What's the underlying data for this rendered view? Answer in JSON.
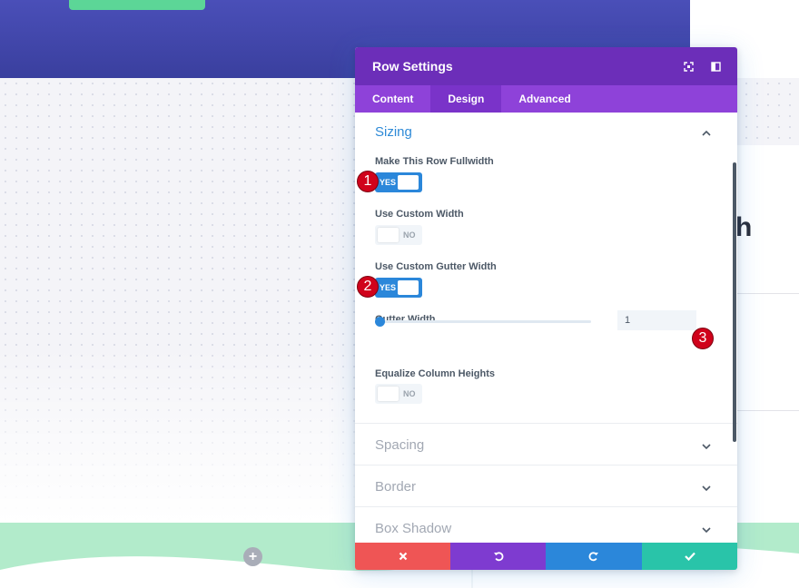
{
  "modal": {
    "title": "Row Settings",
    "tabs": [
      {
        "label": "Content",
        "active": false
      },
      {
        "label": "Design",
        "active": true
      },
      {
        "label": "Advanced",
        "active": false
      }
    ],
    "section_open": {
      "title": "Sizing",
      "options": [
        {
          "label": "Make This Row Fullwidth",
          "toggle": "YES"
        },
        {
          "label": "Use Custom Width",
          "toggle": "NO"
        },
        {
          "label": "Use Custom Gutter Width",
          "toggle": "YES"
        },
        {
          "label": "Gutter Width",
          "value": "1"
        },
        {
          "label": "Equalize Column Heights",
          "toggle": "NO"
        }
      ]
    },
    "sections_closed": [
      "Spacing",
      "Border",
      "Box Shadow"
    ],
    "badges": [
      "1",
      "2",
      "3"
    ],
    "footer": {
      "cancel_icon": "close-icon",
      "undo_icon": "undo-icon",
      "redo_icon": "redo-icon",
      "save_icon": "check-icon"
    }
  },
  "background": {
    "partial_heading": "h",
    "add_icon": "+"
  },
  "colors": {
    "header": "#6c2eb9",
    "tabs": "#8e42d9",
    "accent_blue": "#2b87da",
    "cancel": "#ef5555",
    "undo": "#7e3bd0",
    "redo": "#2b87da",
    "save": "#29c4a9",
    "badge": "#d0021b"
  }
}
